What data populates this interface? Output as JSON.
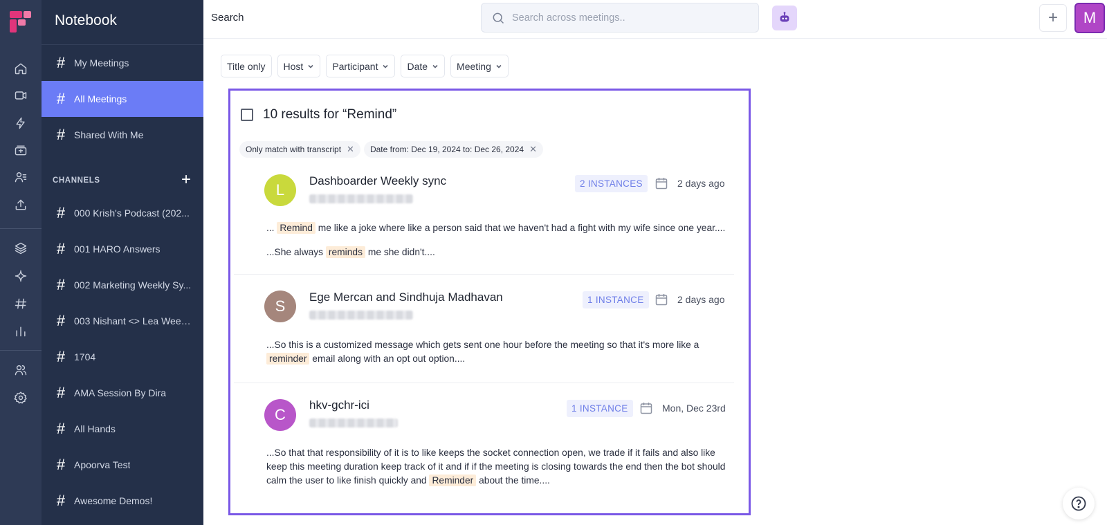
{
  "app": {
    "brand_color": "#e0357b",
    "sidebar_title": "Notebook"
  },
  "rail": {
    "icons": [
      "home-icon",
      "video-icon",
      "lightning-icon",
      "meetings-box-icon",
      "contacts-icon",
      "upload-icon",
      "layers-icon",
      "sparkle-icon",
      "hashtag-icon",
      "bar-chart-icon",
      "team-icon",
      "settings-icon"
    ]
  },
  "sidebar": {
    "nav": [
      {
        "label": "My Meetings"
      },
      {
        "label": "All Meetings",
        "active": true
      },
      {
        "label": "Shared With Me"
      }
    ],
    "channels_header": "CHANNELS",
    "channels_add": "+",
    "channels": [
      {
        "label": "000 Krish's Podcast (202..."
      },
      {
        "label": "001 HARO Answers"
      },
      {
        "label": "002 Marketing Weekly Sy..."
      },
      {
        "label": "003 Nishant <> Lea Week..."
      },
      {
        "label": "1704"
      },
      {
        "label": "AMA Session By Dira"
      },
      {
        "label": "All Hands"
      },
      {
        "label": "Apoorva Test"
      },
      {
        "label": "Awesome Demos!"
      }
    ]
  },
  "header": {
    "title": "Search",
    "search_placeholder": "Search across meetings..",
    "plus_label": "+",
    "avatar_letter": "M"
  },
  "filters": [
    {
      "label": "Title only",
      "dropdown": false
    },
    {
      "label": "Host",
      "dropdown": true
    },
    {
      "label": "Participant",
      "dropdown": true
    },
    {
      "label": "Date",
      "dropdown": true
    },
    {
      "label": "Meeting",
      "dropdown": true
    }
  ],
  "results": {
    "heading": "10 results for “Remind”",
    "tags": [
      {
        "label": "Only match with transcript"
      },
      {
        "label": "Date from: Dec 19, 2024 to: Dec 26, 2024"
      }
    ],
    "items": [
      {
        "avatar_letter": "L",
        "avatar_color": "#c9d93c",
        "title": "Dashboarder Weekly sync",
        "badge": "2 INSTANCES",
        "date": "2 days ago",
        "snippets": [
          {
            "pre": "...",
            "hl": "Remind",
            "post": "me like a joke where like a person said that we haven't had a fight with my wife since one year...."
          },
          {
            "pre": "...She always",
            "hl": "reminds",
            "post": "me she didn't...."
          }
        ]
      },
      {
        "avatar_letter": "S",
        "avatar_color": "#a5867c",
        "title": "Ege Mercan and Sindhuja Madhavan",
        "badge": "1 INSTANCE",
        "date": "2 days ago",
        "snippets": [
          {
            "pre": "...So this is a customized message which gets sent one hour before the meeting so that it's more like a",
            "hl": "reminder",
            "post": "email along with an opt out option...."
          }
        ]
      },
      {
        "avatar_letter": "C",
        "avatar_color": "#b856c9",
        "title": "hkv-gchr-ici",
        "badge": "1 INSTANCE",
        "date": "Mon, Dec 23rd",
        "snippets": [
          {
            "pre": "...So that that responsibility of it is to like keeps the socket connection open, we trade if it fails and also like keep this meeting duration keep track of it and if if the meeting is closing towards the end then the bot should calm the user to like finish quickly and",
            "hl": "Reminder",
            "post": "about the time...."
          }
        ]
      }
    ]
  }
}
